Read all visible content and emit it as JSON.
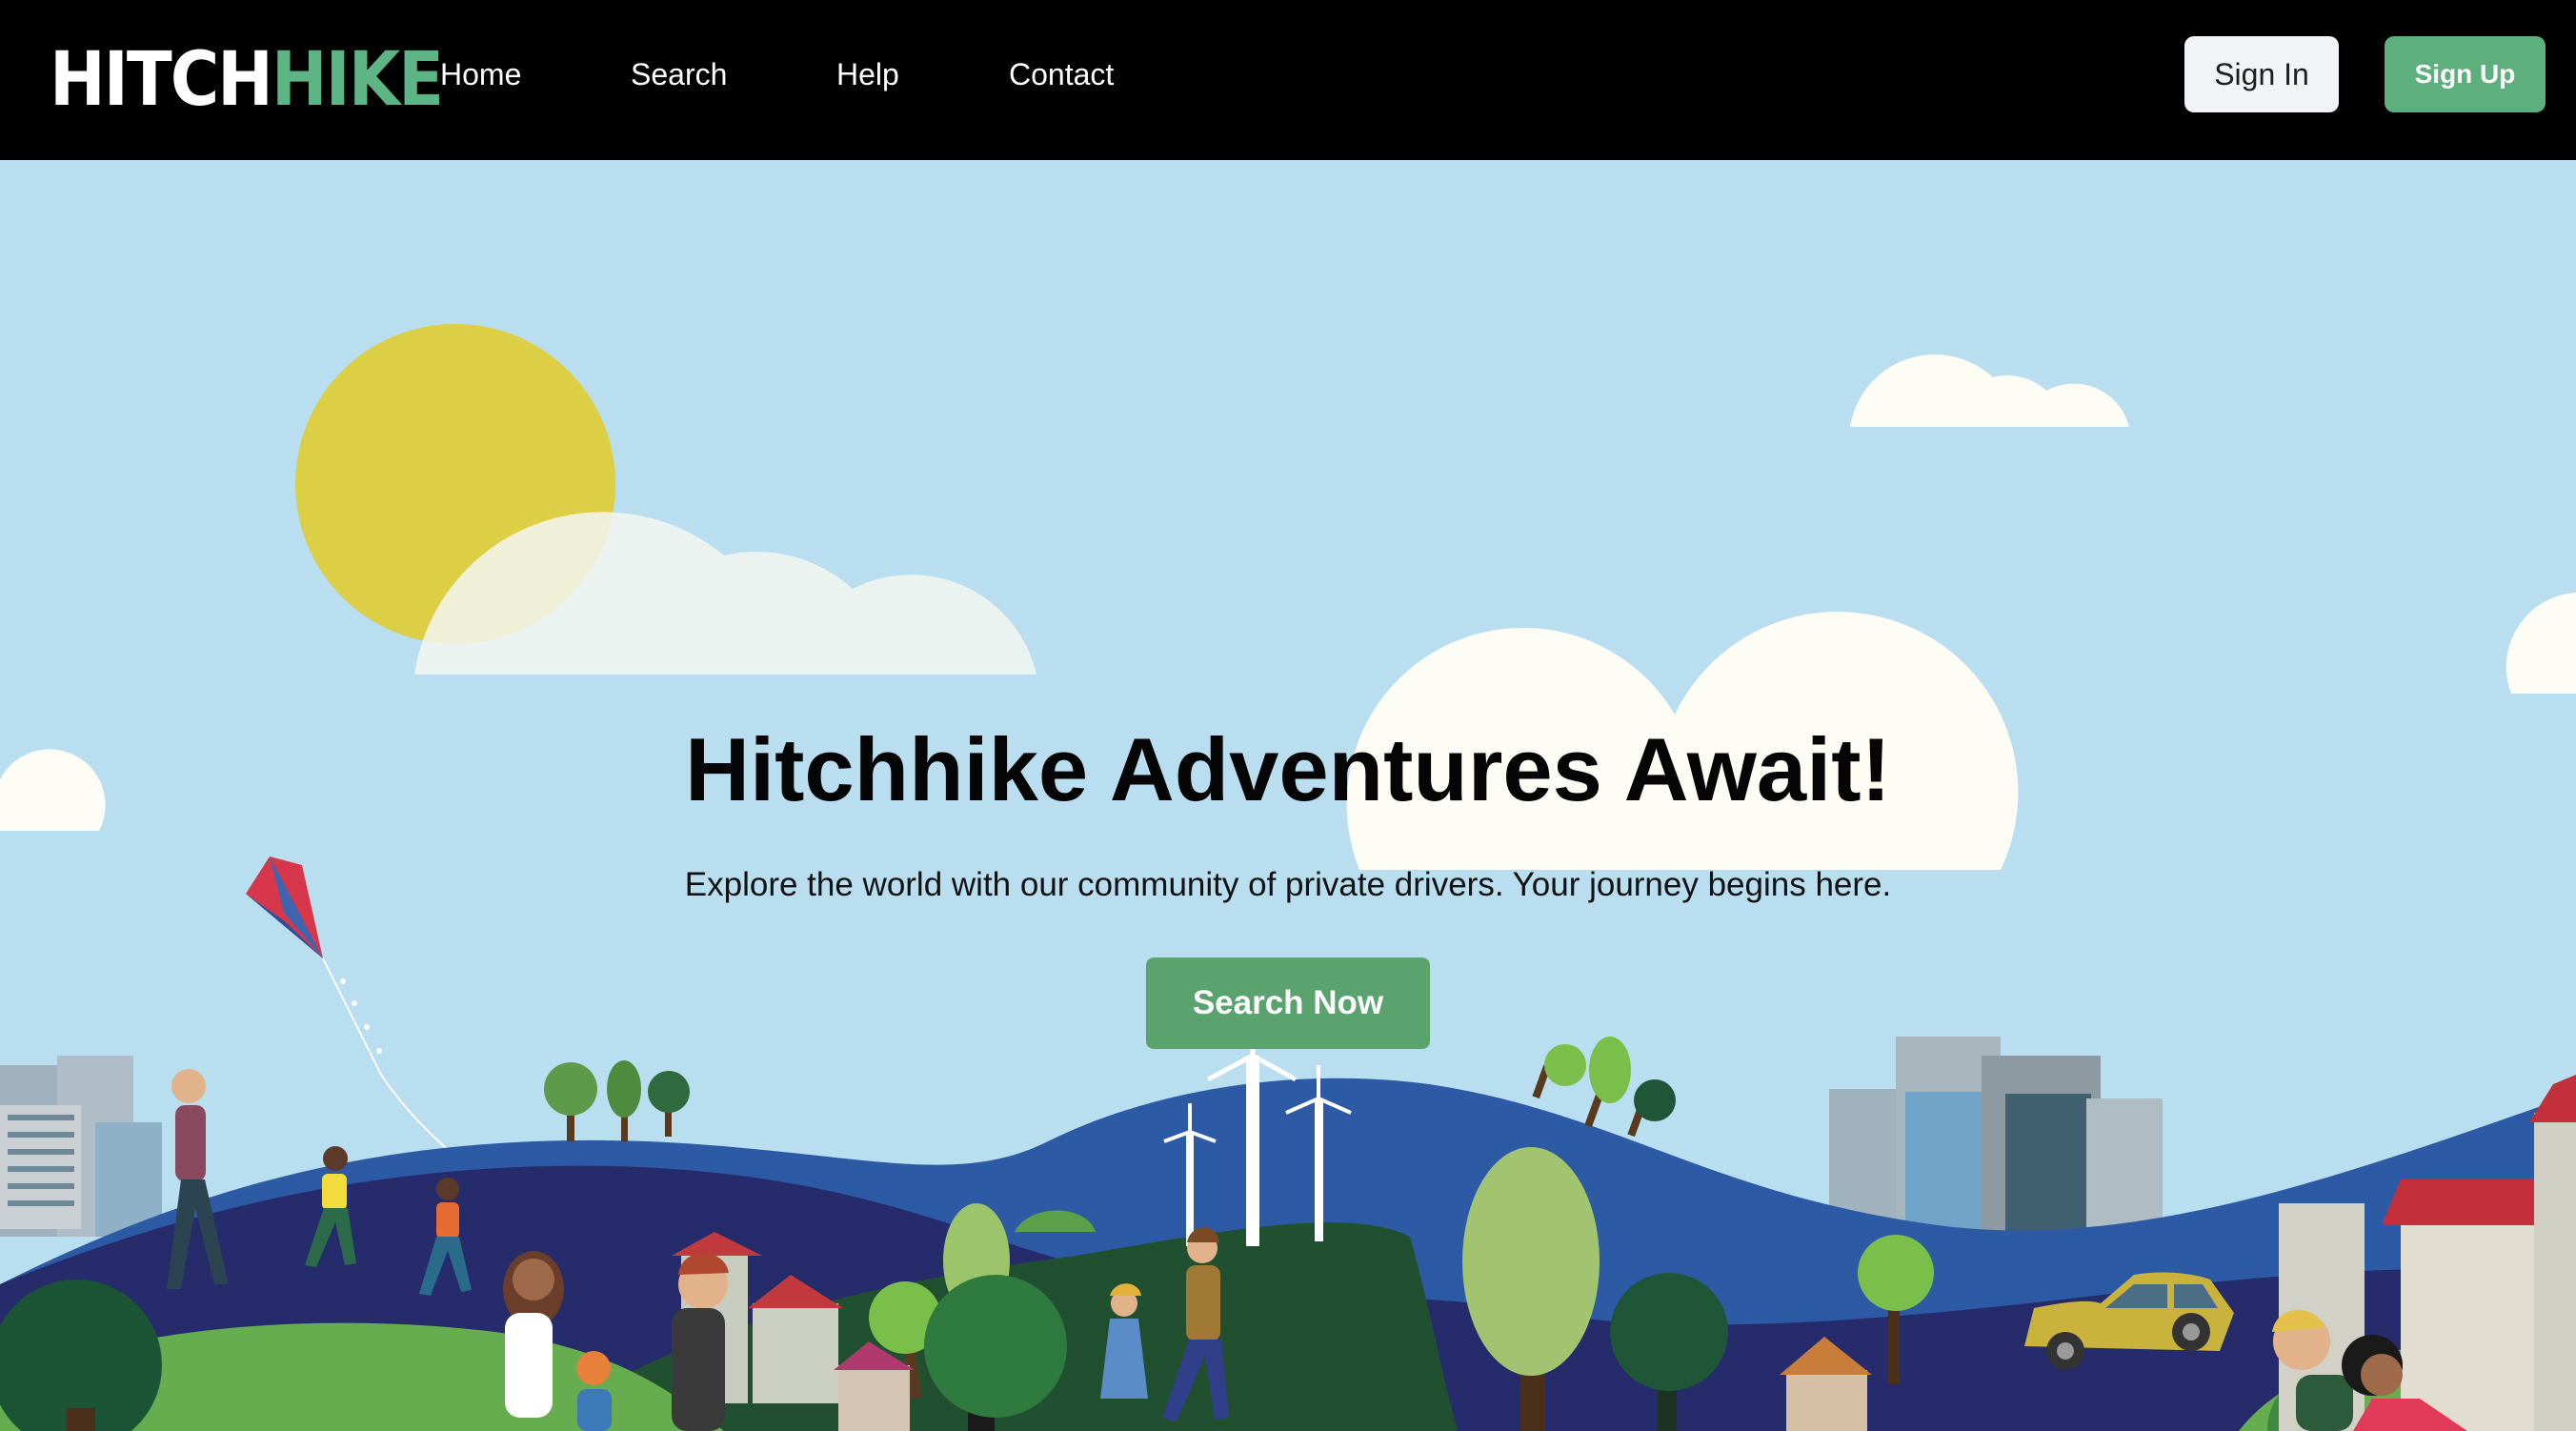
{
  "logo": {
    "part1": "HITCH",
    "part2": "HIKE"
  },
  "nav": {
    "home": "Home",
    "search": "Search",
    "help": "Help",
    "contact": "Contact"
  },
  "auth": {
    "sign_in": "Sign In",
    "sign_up": "Sign Up"
  },
  "hero": {
    "headline": "Hitchhike Adventures Await!",
    "subtext": "Explore the world with our community of private drivers. Your journey begins here.",
    "cta": "Search Now"
  },
  "colors": {
    "navbar": "#000000",
    "brand_green": "#5db586",
    "sky": "#b9def0",
    "cta_green": "#5aa36f"
  }
}
